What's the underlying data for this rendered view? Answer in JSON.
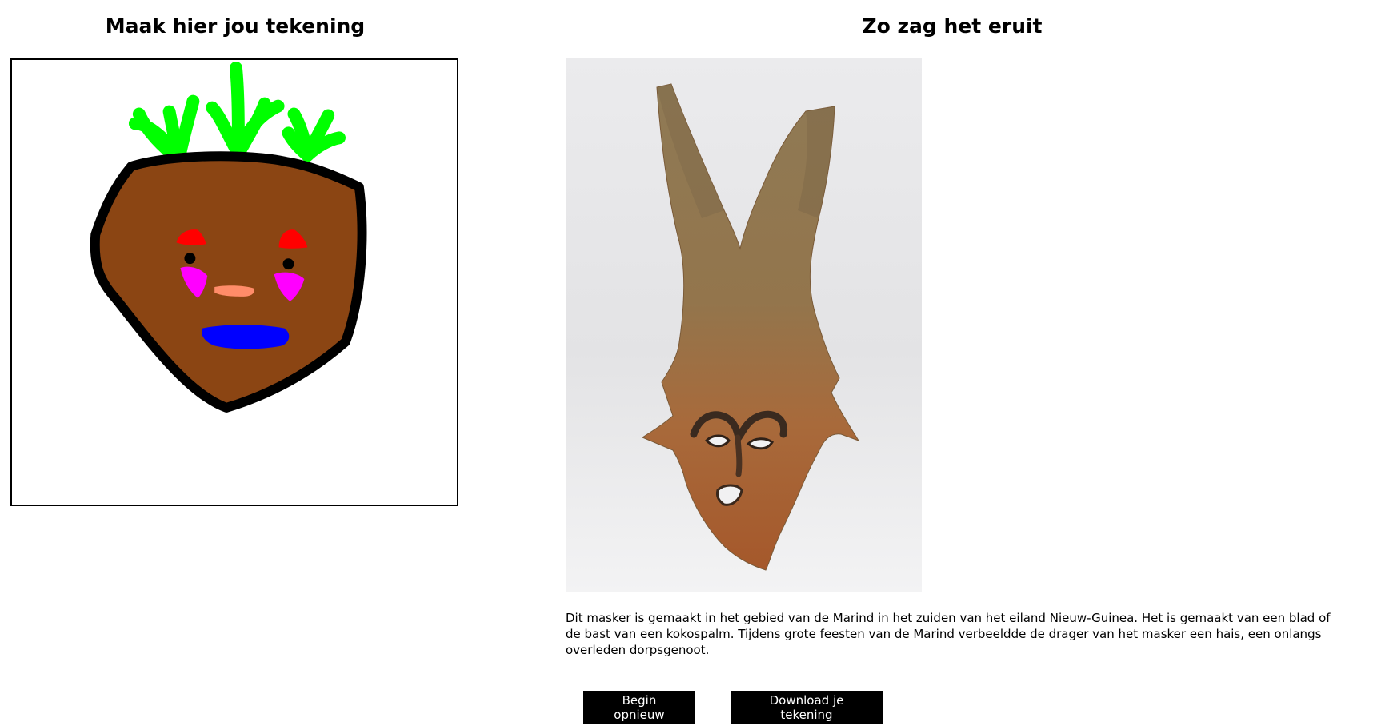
{
  "left_panel": {
    "heading": "Maak hier jou tekening"
  },
  "right_panel": {
    "heading": "Zo zag het eruit",
    "description": "Dit masker is gemaakt in het gebied van de Marind in het zuiden van het eiland Nieuw-Guinea. Het is gemaakt van een blad of de bast van een kokospalm. Tijdens grote feesten van de Marind verbeeldde de drager van het masker een hais, een onlangs overleden dorpsgenoot."
  },
  "actions": {
    "restart_label": "Begin opnieuw",
    "download_label": "Download je tekening"
  },
  "colors": {
    "button_bg": "#000000",
    "button_text": "#ffffff",
    "drawing_face": "#8b4513",
    "drawing_hair": "#00ff00",
    "drawing_mouth": "#0000ff",
    "drawing_eyebrows": "#ff0000",
    "drawing_cheeks": "#ff00ff",
    "drawing_nose": "#ff8c69"
  }
}
